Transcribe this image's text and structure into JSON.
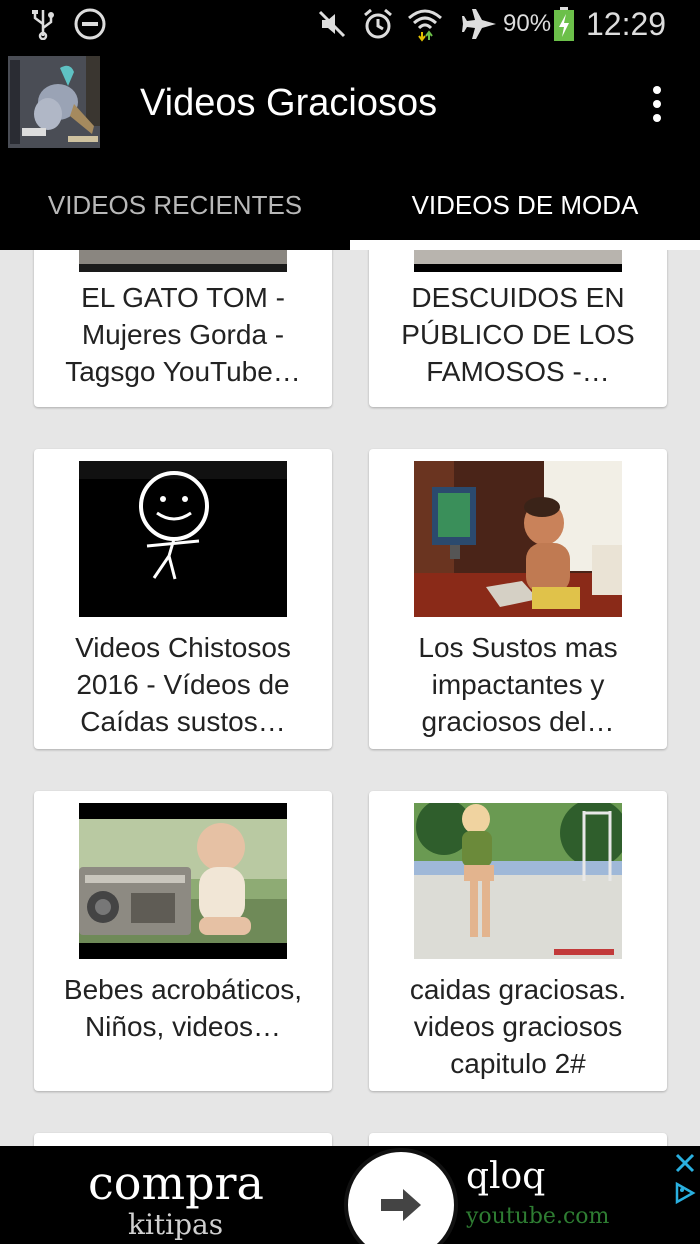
{
  "status_bar": {
    "battery": "90%",
    "time": "12:29",
    "icons": [
      "usb-icon",
      "do-not-disturb-icon",
      "mute-icon",
      "alarm-icon",
      "wifi-icon",
      "airplane-icon",
      "battery-icon"
    ]
  },
  "app_bar": {
    "title": "Videos Graciosos",
    "menu_icon": "overflow-menu-icon"
  },
  "tabs": [
    {
      "label": "VIDEOS RECIENTES",
      "selected": false
    },
    {
      "label": "VIDEOS DE MODA",
      "selected": true
    }
  ],
  "videos": [
    {
      "title": "EL GATO TOM - Mujeres Gorda - Tagsgo YouTube…"
    },
    {
      "title": "DESCUIDOS EN PÚBLICO DE LOS FAMOSOS -…"
    },
    {
      "title": "Videos Chistosos 2016 - Vídeos de Caídas sustos…"
    },
    {
      "title": "Los Sustos mas impactantes y graciosos del…"
    },
    {
      "title": "Bebes acrobáticos, Niños, videos…"
    },
    {
      "title": "caidas graciosas. videos graciosos capitulo 2#"
    }
  ],
  "ad": {
    "headline": "compra",
    "subline": "kitipas",
    "advertiser": "qloq",
    "domain": "youtube.com"
  },
  "colors": {
    "bar_background": "#000000",
    "list_background": "#e6e6e6",
    "card_background": "#ffffff",
    "ad_url": "#2e7d32"
  }
}
